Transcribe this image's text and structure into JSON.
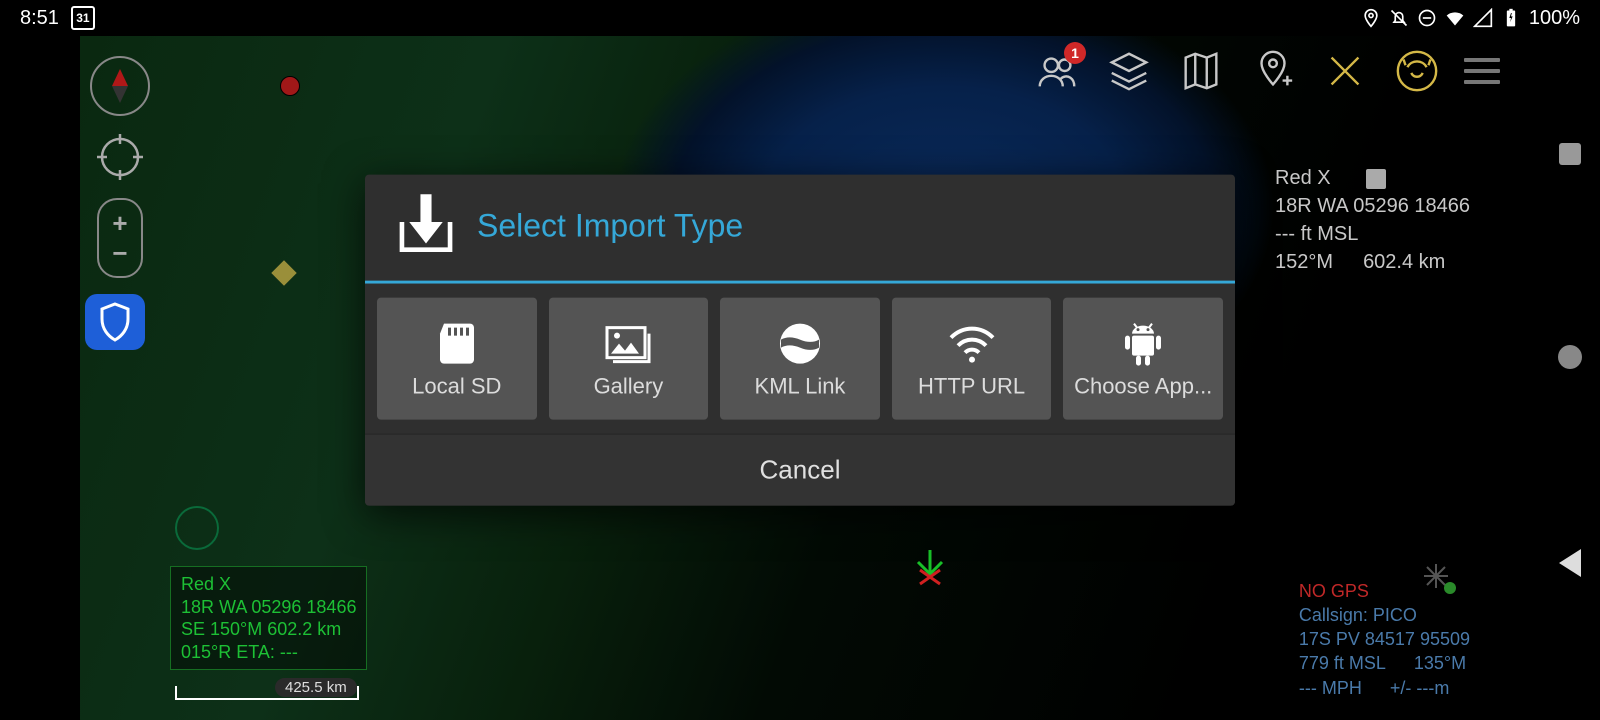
{
  "statusbar": {
    "time": "8:51",
    "calendar": "31",
    "battery": "100%"
  },
  "toolbar": {
    "contacts_badge": "1"
  },
  "sidepanel": {
    "title": "Red X",
    "mgrs": "18R WA 05296 18466",
    "alt": "--- ft MSL",
    "bearing": "152°M",
    "distance": "602.4 km"
  },
  "greenbox": {
    "line1": "Red X",
    "line2": "18R  WA  05296  18466",
    "line3": "SE   150°M 602.2 km",
    "line4": "015°R   ETA: ---"
  },
  "scale": {
    "label": "425.5 km"
  },
  "gps": {
    "status": "NO GPS",
    "callsign": "Callsign: PICO",
    "mgrs": "17S  PV  84517  95509",
    "alt": "779 ft MSL",
    "bearing": "135°M",
    "speed": "--- MPH",
    "accuracy": "+/- ---m"
  },
  "dialog": {
    "title": "Select Import Type",
    "options": {
      "sd": "Local SD",
      "gallery": "Gallery",
      "kml": "KML Link",
      "http": "HTTP URL",
      "app": "Choose App..."
    },
    "cancel": "Cancel"
  }
}
